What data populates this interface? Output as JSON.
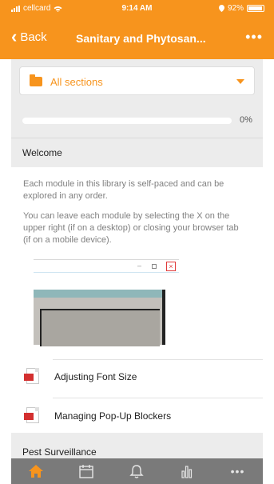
{
  "statusbar": {
    "carrier": "cellcard",
    "time": "9:14 AM",
    "battery": "92%"
  },
  "navbar": {
    "back_label": "Back",
    "title": "Sanitary and Phytosan...",
    "more_icon": "more-dots-icon"
  },
  "filter": {
    "selected": "All sections"
  },
  "progress": {
    "value": 0,
    "label": "0%"
  },
  "section": {
    "title": "Welcome",
    "paragraph1": "Each module in this library is self-paced and can be explored in any order.",
    "paragraph2": "You can leave each module by selecting the X on the upper right (if on a desktop) or closing your browser tab (if on a mobile device)."
  },
  "items": [
    {
      "label": "Adjusting Font Size",
      "icon": "pdf-icon"
    },
    {
      "label": "Managing Pop-Up Blockers",
      "icon": "pdf-icon"
    }
  ],
  "next_section": {
    "title": "Pest Surveillance"
  },
  "tabbar": {
    "tabs": [
      {
        "icon": "home-icon",
        "active": true
      },
      {
        "icon": "calendar-icon",
        "active": false
      },
      {
        "icon": "bell-icon",
        "active": false
      },
      {
        "icon": "bar-chart-icon",
        "active": false
      },
      {
        "icon": "more-dots-icon",
        "active": false
      }
    ]
  },
  "colors": {
    "accent": "#f7941d",
    "tabbar": "#7a7a7a",
    "background": "#ececec"
  }
}
